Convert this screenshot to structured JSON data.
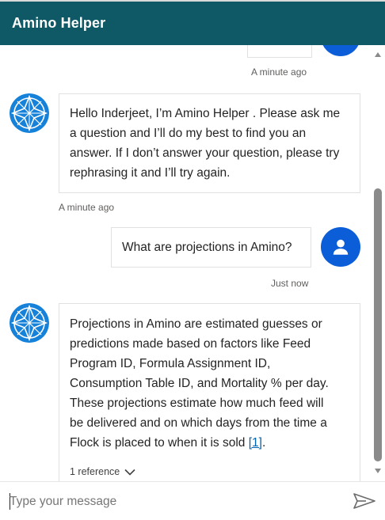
{
  "header": {
    "title": "Amino Helper"
  },
  "messages": [
    {
      "role": "user",
      "text": "",
      "timestamp": "A minute ago"
    },
    {
      "role": "bot",
      "lines": [
        "Hello Inderjeet, I’m Amino Helper . Please ask me",
        "a question and I’ll do my best to find you an",
        "answer. If I don’t answer your question, please try",
        "rephrasing it and I’ll try again."
      ],
      "timestamp": "A minute ago"
    },
    {
      "role": "user",
      "text": "What are projections in Amino?",
      "timestamp": "Just now"
    },
    {
      "role": "bot",
      "lines": [
        "Projections in Amino are estimated guesses or",
        "predictions made based on factors like Feed",
        "Program ID, Formula Assignment ID,",
        "Consumption Table ID, and Mortality % per day.",
        "These projections estimate how much feed will",
        "be delivered and on which days from the time a",
        "Flock is placed to when it is sold "
      ],
      "citation": "[1]",
      "trailing": ".",
      "references_label": "1 reference"
    }
  ],
  "composer": {
    "placeholder": "Type your message"
  },
  "colors": {
    "header_bg": "#0f5966",
    "user_avatar": "#0c5ed8",
    "bot_avatar": "#1681d9",
    "link": "#0063b1"
  },
  "icons": {
    "bot_avatar": "amino-star-logo-icon",
    "user_avatar": "person-icon",
    "send": "send-arrow-icon",
    "references": "chevron-down-icon"
  }
}
